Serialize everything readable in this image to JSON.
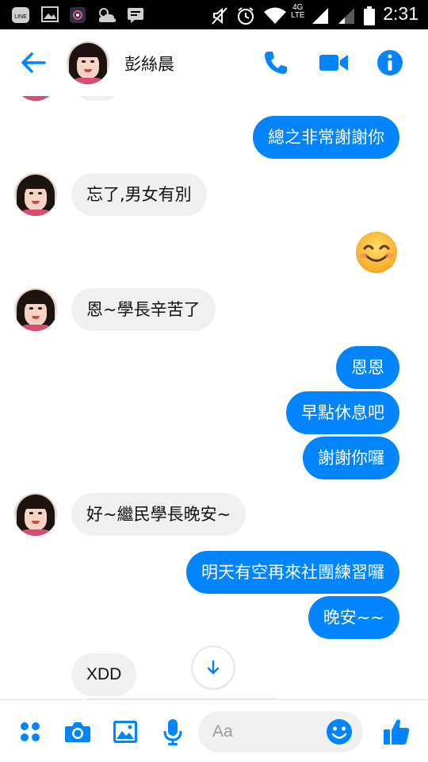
{
  "status_bar": {
    "time": "2:31",
    "network": "4G",
    "network_sub": "LTE",
    "left_icons": [
      "line-icon",
      "image-icon",
      "app-icon",
      "weather-icon",
      "message-icon"
    ],
    "right_icons": [
      "mute-icon",
      "alarm-icon",
      "wifi-icon",
      "signal-icon",
      "battery-icon"
    ]
  },
  "header": {
    "contact_name": "彭絲晨"
  },
  "messages": [
    {
      "from": "me",
      "text": "總之非常謝謝你"
    },
    {
      "from": "them",
      "text": "忘了,男女有別"
    },
    {
      "from": "me",
      "emoji": "smiling-face-emoji"
    },
    {
      "from": "them",
      "text": "恩~學長辛苦了"
    },
    {
      "from": "me",
      "text": "恩恩"
    },
    {
      "from": "me",
      "text": "早點休息吧"
    },
    {
      "from": "me",
      "text": "謝謝你囉"
    },
    {
      "from": "them",
      "text": "好~繼民學長晚安~"
    },
    {
      "from": "me",
      "text": "明天有空再來社團練習囉"
    },
    {
      "from": "me",
      "text": "晚安~~"
    },
    {
      "from": "them",
      "text": "XDD"
    }
  ],
  "composer": {
    "placeholder": "Aa"
  },
  "colors": {
    "accent": "#0084ff",
    "incoming_bubble": "#f1f0f0",
    "outgoing_text": "#ffffff"
  }
}
